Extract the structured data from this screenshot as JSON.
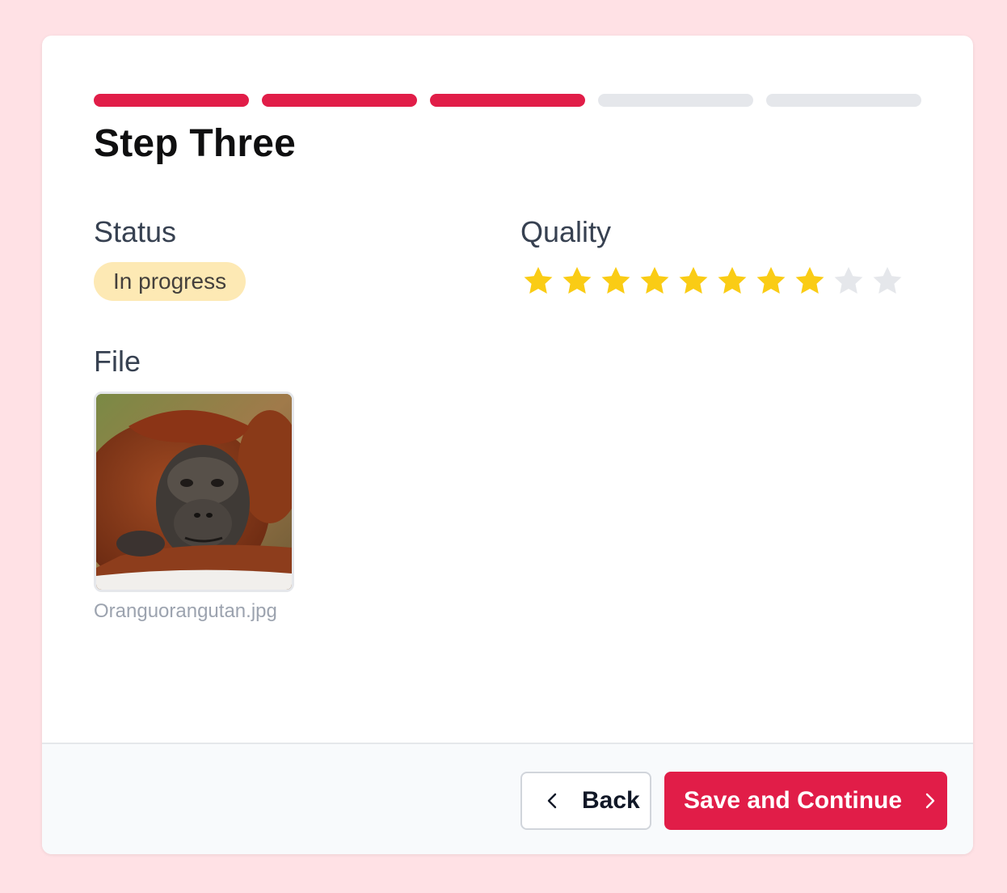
{
  "progress": {
    "total_steps": 5,
    "completed_steps": 3,
    "active_color": "#e11d48",
    "inactive_color": "#e5e7eb"
  },
  "title": "Step Three",
  "status": {
    "label": "Status",
    "value": "In progress",
    "badge_color": "#fde9b4"
  },
  "quality": {
    "label": "Quality",
    "rating": 8,
    "max": 10,
    "filled_color": "#facc15",
    "empty_color": "#e5e7eb"
  },
  "file": {
    "label": "File",
    "filename": "Oranguorangutan.jpg",
    "thumbnail_icon": "orangutan-photo"
  },
  "footer": {
    "back_label": "Back",
    "back_icon": "chevron-left-icon",
    "save_label": "Save and Continue",
    "save_icon": "chevron-right-icon"
  }
}
